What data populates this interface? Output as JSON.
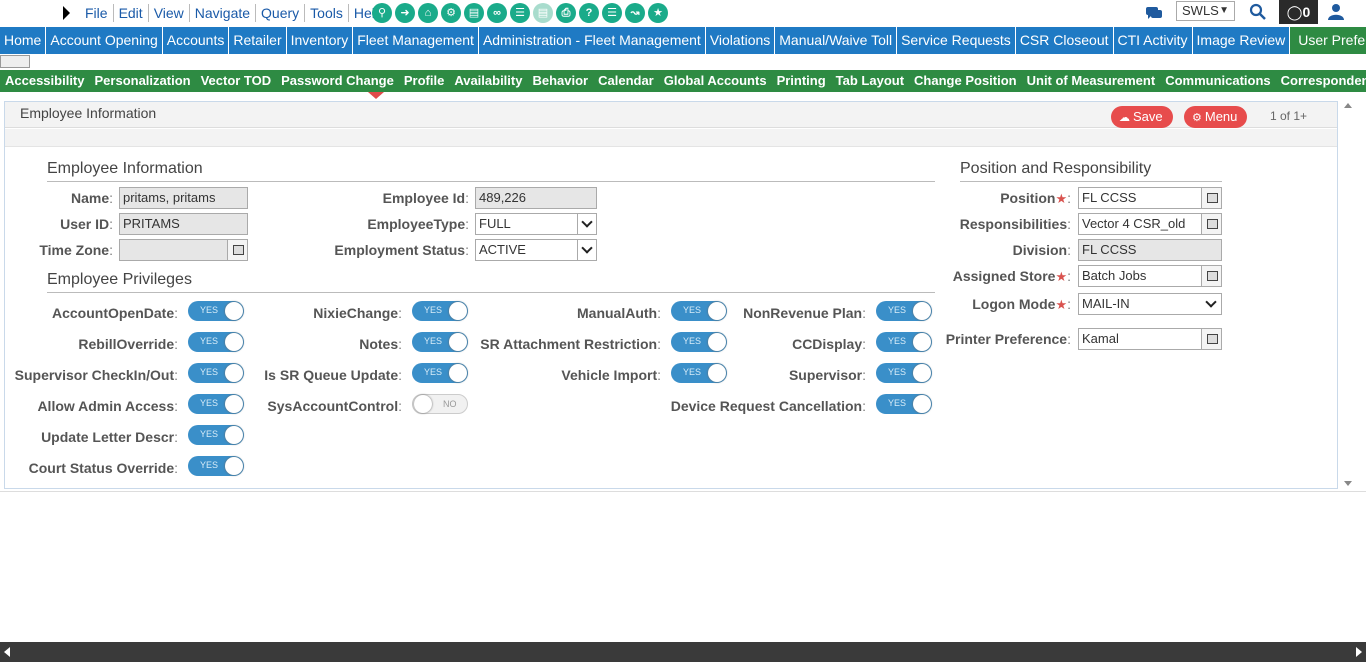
{
  "menu": [
    "File",
    "Edit",
    "View",
    "Navigate",
    "Query",
    "Tools",
    "Help"
  ],
  "toolbar_icons": [
    "search-icon",
    "forward-icon",
    "home-icon",
    "key-icon",
    "clipboard-icon",
    "link-icon",
    "list-icon",
    "document-icon",
    "print-icon",
    "help-icon",
    "list-alt-icon",
    "chart-icon",
    "star-icon"
  ],
  "top_right": {
    "site": "SWLS",
    "notifications": "0"
  },
  "nav": [
    "Home",
    "Account Opening",
    "Accounts",
    "Retailer",
    "Inventory",
    "Fleet Management",
    "Administration - Fleet Management",
    "Violations",
    "Manual/Waive Toll",
    "Service Requests",
    "CSR Closeout",
    "CTI Activity",
    "Image Review",
    "User Preferences"
  ],
  "nav_active": "User Preferences",
  "subnav": [
    "Accessibility",
    "Personalization",
    "Vector TOD",
    "Password Change",
    "Profile",
    "Availability",
    "Behavior",
    "Calendar",
    "Global Accounts",
    "Printing",
    "Tab Layout",
    "Change Position",
    "Unit of Measurement",
    "Communications",
    "Correspondence"
  ],
  "subnav_active": "Profile",
  "panel": {
    "title": "Employee Information",
    "save": "Save",
    "menu": "Menu",
    "pager": "1 of 1+"
  },
  "employee": {
    "section": "Employee Information",
    "name_label": "Name",
    "name": "pritams, pritams",
    "userid_label": "User ID",
    "userid": "PRITAMS",
    "timezone_label": "Time Zone",
    "timezone": "",
    "empid_label": "Employee Id",
    "empid": "489,226",
    "emptype_label": "EmployeeType",
    "emptype": "FULL",
    "status_label": "Employment Status",
    "status": "ACTIVE"
  },
  "privileges": {
    "section": "Employee Privileges",
    "on": "YES",
    "off": "NO",
    "items": {
      "account_open_date": {
        "label": "AccountOpenDate",
        "value": true
      },
      "rebill_override": {
        "label": "RebillOverride",
        "value": true
      },
      "supervisor_checkin": {
        "label": "Supervisor CheckIn/Out",
        "value": true
      },
      "allow_admin": {
        "label": "Allow Admin Access",
        "value": true
      },
      "update_letter": {
        "label": "Update Letter Descr",
        "value": true
      },
      "court_status": {
        "label": "Court Status Override",
        "value": true
      },
      "nixie_change": {
        "label": "NixieChange",
        "value": true
      },
      "notes": {
        "label": "Notes",
        "value": true
      },
      "sr_queue": {
        "label": "Is SR Queue Update",
        "value": true
      },
      "sys_account": {
        "label": "SysAccountControl",
        "value": false
      },
      "manual_auth": {
        "label": "ManualAuth",
        "value": true
      },
      "sr_attach": {
        "label": "SR Attachment Restriction",
        "value": true
      },
      "vehicle_import": {
        "label": "Vehicle Import",
        "value": true
      },
      "nonrevenue": {
        "label": "NonRevenue Plan",
        "value": true
      },
      "ccdisplay": {
        "label": "CCDisplay",
        "value": true
      },
      "supervisor": {
        "label": "Supervisor",
        "value": true
      },
      "device_cancel": {
        "label": "Device Request Cancellation",
        "value": true
      }
    }
  },
  "position": {
    "section": "Position and Responsibility",
    "position_label": "Position",
    "position": "FL CCSS",
    "resp_label": "Responsibilities",
    "resp": "Vector 4 CSR_old",
    "division_label": "Division",
    "division": "FL CCSS",
    "store_label": "Assigned Store",
    "store": "Batch Jobs",
    "logon_label": "Logon Mode",
    "logon": "MAIL-IN",
    "printer_label": "Printer Preference",
    "printer": "Kamal"
  },
  "colors": {
    "nav_blue": "#1f7ac4",
    "nav_green": "#2e8b43",
    "toggle_on": "#3a8fc9",
    "button_red": "#e74c4c",
    "tool_teal": "#1aab8a"
  }
}
